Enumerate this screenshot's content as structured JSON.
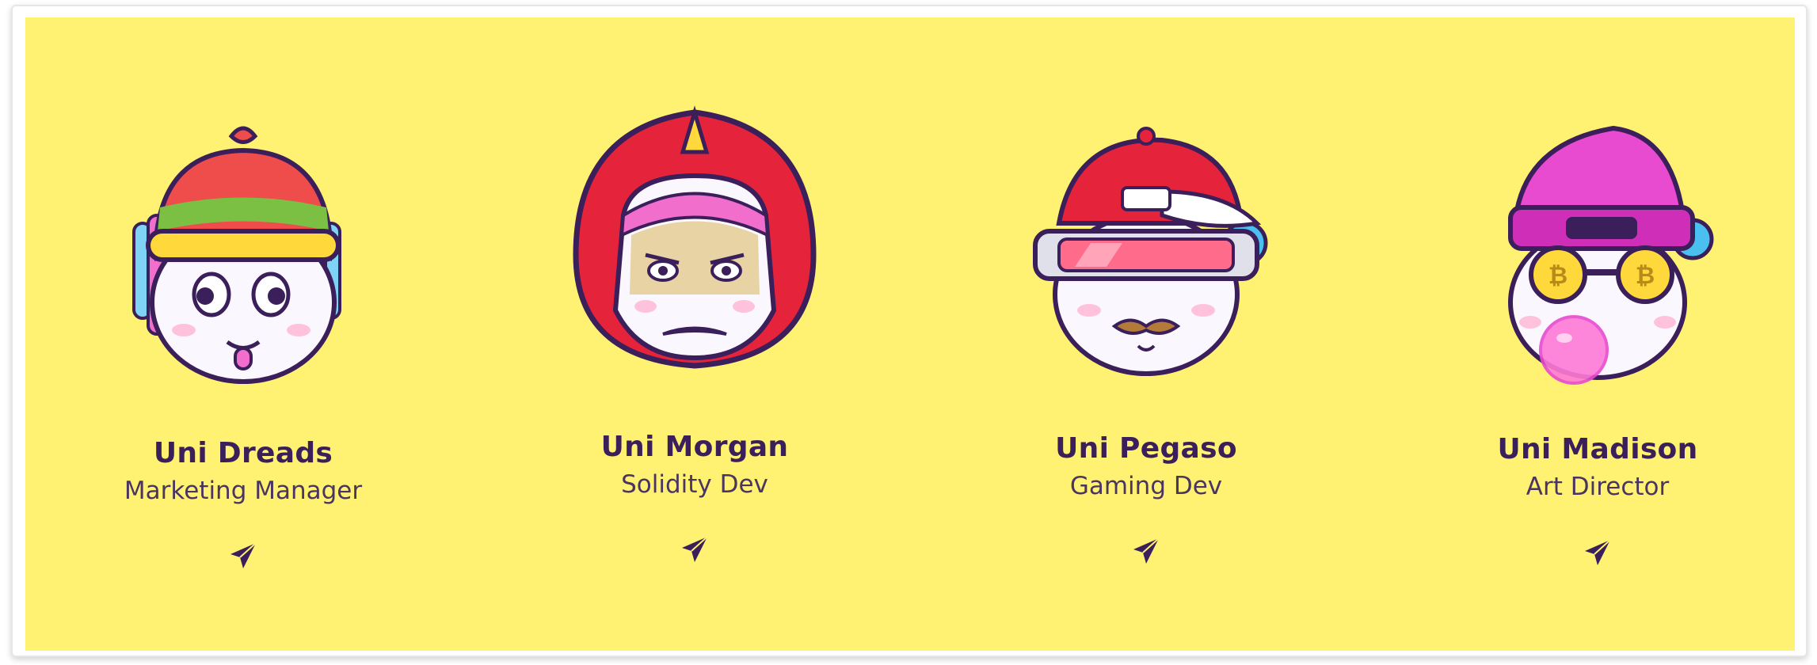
{
  "team": {
    "members": [
      {
        "name": "Uni Dreads",
        "role": "Marketing Manager",
        "avatar": "unicorn-dreads-beanie-icon"
      },
      {
        "name": "Uni Morgan",
        "role": "Solidity Dev",
        "avatar": "unicorn-red-hood-icon"
      },
      {
        "name": "Uni Pegaso",
        "role": "Gaming Dev",
        "avatar": "unicorn-visor-cap-icon"
      },
      {
        "name": "Uni Madison",
        "role": "Art Director",
        "avatar": "unicorn-pink-beanie-bubblegum-icon"
      }
    ],
    "contact_icon": "send-plane-icon"
  },
  "colors": {
    "panel_background": "#fff273",
    "name_text": "#3a1f5a",
    "role_text": "#4a3560",
    "icon": "#3a1f5a"
  }
}
